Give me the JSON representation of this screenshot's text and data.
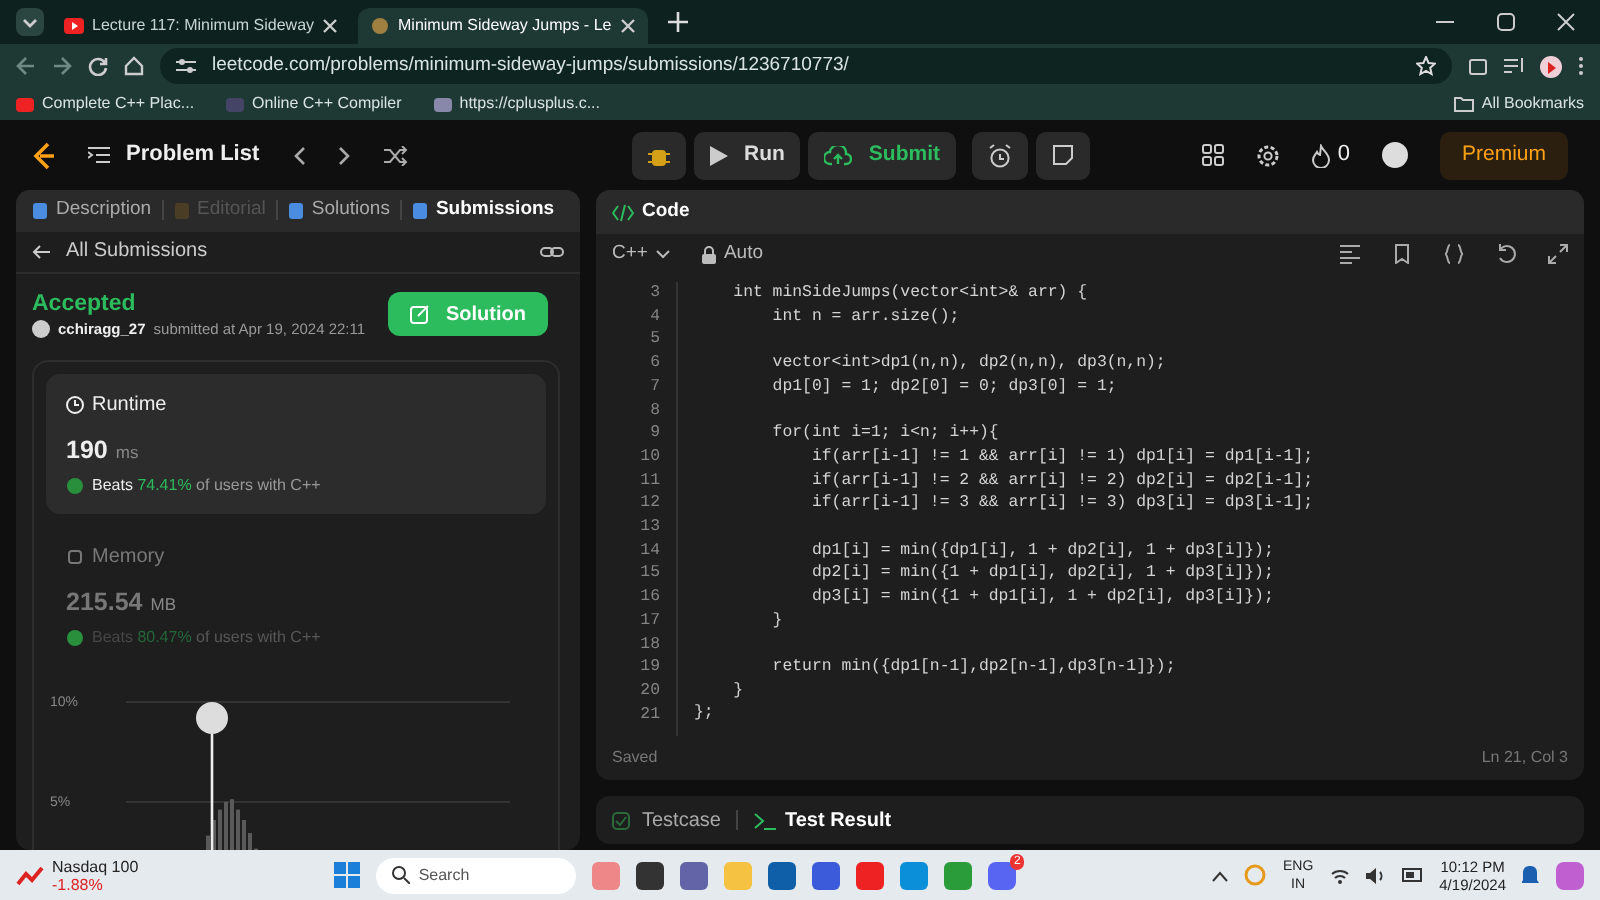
{
  "browser": {
    "tabs": [
      {
        "title": "Lecture 117: Minimum Sideway",
        "selected": false
      },
      {
        "title": "Minimum Sideway Jumps - Le",
        "selected": true
      }
    ],
    "url": "leetcode.com/problems/minimum-sideway-jumps/submissions/1236710773/",
    "bookmarks": [
      "Complete C++ Plac...",
      "Online C++ Compiler",
      "https://cplusplus.c..."
    ],
    "all_bookmarks": "All Bookmarks"
  },
  "header": {
    "problem_list": "Problem List",
    "run": "Run",
    "submit": "Submit",
    "streak": "0",
    "premium": "Premium"
  },
  "left_panel": {
    "tabs": [
      {
        "label": "Description",
        "selected": false,
        "disabled": false
      },
      {
        "label": "Editorial",
        "selected": false,
        "disabled": true
      },
      {
        "label": "Solutions",
        "selected": false,
        "disabled": false
      },
      {
        "label": "Submissions",
        "selected": true,
        "disabled": false
      }
    ],
    "back_link": "All Submissions",
    "status": "Accepted",
    "user": "cchiragg_27",
    "submitted": "submitted at Apr 19, 2024 22:11",
    "solution_button": "Solution",
    "stats": [
      {
        "title": "Runtime",
        "value": "190",
        "unit": "ms",
        "beats_label": "Beats",
        "beats": "74.41%",
        "suffix": "of users with C++",
        "selected": true
      },
      {
        "title": "Memory",
        "value": "215.54",
        "unit": "MB",
        "beats_label": "Beats",
        "beats": "80.47%",
        "suffix": "of users with C++",
        "selected": false
      }
    ],
    "histogram_labels": [
      "10%",
      "5%"
    ]
  },
  "editor": {
    "title": "Code",
    "language": "C++",
    "mode": "Auto",
    "lines": [
      {
        "number": "3",
        "text": "    int minSideJumps(vector<int>& arr) {"
      },
      {
        "number": "4",
        "text": "        int n = arr.size();"
      },
      {
        "number": "5"
      },
      {
        "number": "6",
        "text": "        vector<int>dp1(n,n), dp2(n,n), dp3(n,n);"
      },
      {
        "number": "7",
        "text": "        dp1[0] = 1; dp2[0] = 0; dp3[0] = 1;"
      },
      {
        "number": "8"
      },
      {
        "number": "9",
        "text": "        for(int i=1; i<n; i++){"
      },
      {
        "number": "10",
        "text": "            if(arr[i-1] != 1 && arr[i] != 1) dp1[i] = dp1[i-1];"
      },
      {
        "number": "11",
        "text": "            if(arr[i-1] != 2 && arr[i] != 2) dp2[i] = dp2[i-1];"
      },
      {
        "number": "12",
        "text": "            if(arr[i-1] != 3 && arr[i] != 3) dp3[i] = dp3[i-1];"
      },
      {
        "number": "13"
      },
      {
        "number": "14",
        "text": "            dp1[i] = min({dp1[i], 1 + dp2[i], 1 + dp3[i]});"
      },
      {
        "number": "15",
        "text": "            dp2[i] = min({1 + dp1[i], dp2[i], 1 + dp3[i]});"
      },
      {
        "number": "16",
        "text": "            dp3[i] = min({1 + dp1[i], 1 + dp2[i], dp3[i]});"
      },
      {
        "number": "17",
        "text": "        }"
      },
      {
        "number": "18"
      },
      {
        "number": "19",
        "text": "        return min({dp1[n-1],dp2[n-1],dp3[n-1]});"
      },
      {
        "number": "20",
        "text": "    }"
      },
      {
        "number": "21",
        "text": "};"
      }
    ],
    "status": "Saved",
    "cursor": "Ln 21, Col 3"
  },
  "bottom_tabs": [
    {
      "label": "Testcase",
      "selected": false
    },
    {
      "label": "Test Result",
      "selected": true
    }
  ],
  "taskbar": {
    "widget_name": "Nasdaq 100",
    "widget_change": "-1.88%",
    "search": "Search",
    "chat_badge": "2",
    "language": "ENG",
    "region": "IN",
    "time": "10:12 PM",
    "date": "4/19/2024"
  }
}
